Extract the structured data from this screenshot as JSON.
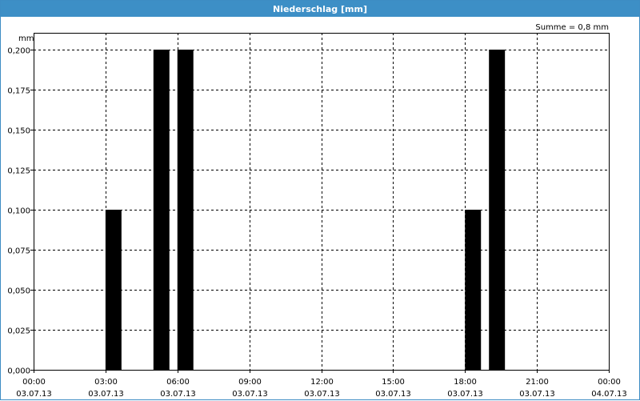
{
  "window": {
    "title": "Niederschlag [mm]"
  },
  "chart_data": {
    "type": "bar",
    "title": "Niederschlag [mm]",
    "ylabel": "mm",
    "summary": "Summe = 0,8 mm",
    "ylim": [
      0,
      0.2
    ],
    "y_ticks": [
      {
        "value": 0.0,
        "label": "0,000"
      },
      {
        "value": 0.025,
        "label": "0,025"
      },
      {
        "value": 0.05,
        "label": "0,050"
      },
      {
        "value": 0.075,
        "label": "0,075"
      },
      {
        "value": 0.1,
        "label": "0,100"
      },
      {
        "value": 0.125,
        "label": "0,125"
      },
      {
        "value": 0.15,
        "label": "0,150"
      },
      {
        "value": 0.175,
        "label": "0,175"
      },
      {
        "value": 0.2,
        "label": "0,200"
      }
    ],
    "x_range_hours": [
      0,
      24
    ],
    "x_ticks": [
      {
        "hour": 0,
        "time": "00:00",
        "date": "03.07.13"
      },
      {
        "hour": 3,
        "time": "03:00",
        "date": "03.07.13"
      },
      {
        "hour": 6,
        "time": "06:00",
        "date": "03.07.13"
      },
      {
        "hour": 9,
        "time": "09:00",
        "date": "03.07.13"
      },
      {
        "hour": 12,
        "time": "12:00",
        "date": "03.07.13"
      },
      {
        "hour": 15,
        "time": "15:00",
        "date": "03.07.13"
      },
      {
        "hour": 18,
        "time": "18:00",
        "date": "03.07.13"
      },
      {
        "hour": 21,
        "time": "21:00",
        "date": "03.07.13"
      },
      {
        "hour": 24,
        "time": "00:00",
        "date": "04.07.13"
      }
    ],
    "bars": [
      {
        "start": "03:00",
        "end": "03:40",
        "value": 0.1
      },
      {
        "start": "05:00",
        "end": "05:40",
        "value": 0.2
      },
      {
        "start": "06:00",
        "end": "06:40",
        "value": 0.2
      },
      {
        "start": "18:00",
        "end": "18:40",
        "value": 0.1
      },
      {
        "start": "19:00",
        "end": "19:40",
        "value": 0.2
      }
    ],
    "grid": true,
    "bar_color": "#000000"
  }
}
